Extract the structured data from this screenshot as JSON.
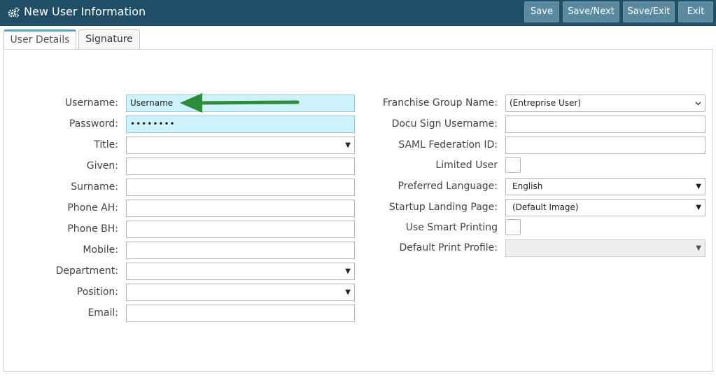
{
  "window": {
    "title": "New User Information"
  },
  "toolbar": {
    "save_label": "Save",
    "save_next_label": "Save/Next",
    "save_exit_label": "Save/Exit",
    "exit_label": "Exit"
  },
  "tabs": [
    {
      "label": "User Details",
      "active": true
    },
    {
      "label": "Signature",
      "active": false
    }
  ],
  "left_form": {
    "username": {
      "label": "Username:",
      "value": "Username"
    },
    "password": {
      "label": "Password:",
      "value": "••••••••"
    },
    "title": {
      "label": "Title:",
      "value": ""
    },
    "given": {
      "label": "Given:",
      "value": ""
    },
    "surname": {
      "label": "Surname:",
      "value": ""
    },
    "phone_ah": {
      "label": "Phone AH:",
      "value": ""
    },
    "phone_bh": {
      "label": "Phone BH:",
      "value": ""
    },
    "mobile": {
      "label": "Mobile:",
      "value": ""
    },
    "department": {
      "label": "Department:",
      "value": ""
    },
    "position": {
      "label": "Position:",
      "value": ""
    },
    "email": {
      "label": "Email:",
      "value": ""
    }
  },
  "right_form": {
    "franchise_group": {
      "label": "Franchise Group Name:",
      "value": "(Entreprise User)"
    },
    "docusign_username": {
      "label": "Docu Sign Username:",
      "value": ""
    },
    "saml_federation_id": {
      "label": "SAML Federation ID:",
      "value": ""
    },
    "limited_user": {
      "label": "Limited User",
      "checked": false
    },
    "preferred_language": {
      "label": "Preferred Language:",
      "value": "English"
    },
    "startup_landing_page": {
      "label": "Startup Landing Page:",
      "value": "(Default Image)"
    },
    "use_smart_printing": {
      "label": "Use Smart Printing",
      "checked": false
    },
    "default_print_profile": {
      "label": "Default Print Profile:",
      "value": ""
    }
  },
  "colors": {
    "titlebar": "#1f4e66",
    "button": "#5b8aa0",
    "highlight_field": "#cdf2fb",
    "annotation_arrow": "#2e8b3a",
    "active_tab_accent": "#5aa4c8"
  },
  "icons": {
    "title": "gears-icon",
    "annotation": "arrow-left-icon"
  }
}
